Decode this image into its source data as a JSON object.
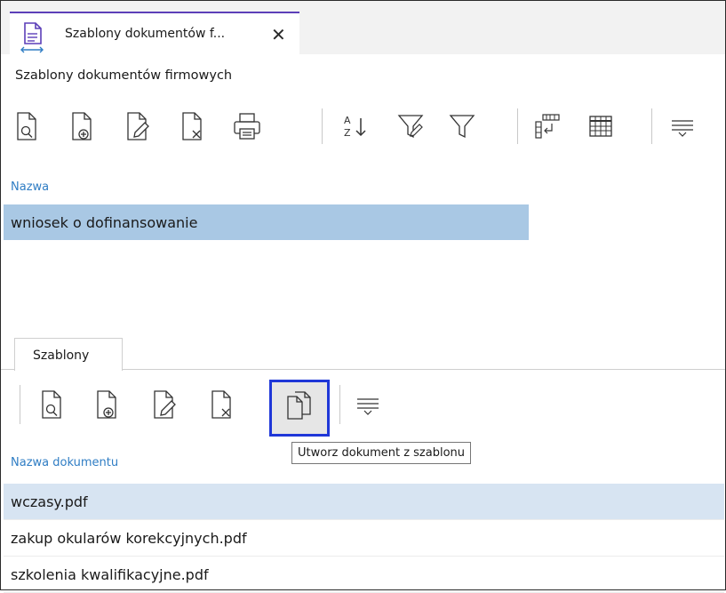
{
  "tab": {
    "title": "Szablony dokumentów f...",
    "icon": "document-arrows-icon"
  },
  "subtitle": "Szablony dokumentów firmowych",
  "toolbar1": {
    "buttons": [
      "preview-icon",
      "add-document-icon",
      "edit-document-icon",
      "delete-document-icon",
      "print-icon",
      "sort-az-icon",
      "filter-clear-icon",
      "filter-icon",
      "column-chooser-icon",
      "grid-icon",
      "more-icon"
    ]
  },
  "list1": {
    "column_header": "Nazwa",
    "rows": [
      "wniosek o dofinansowanie"
    ],
    "selected_index": 0
  },
  "tabs2": {
    "label": "Szablony"
  },
  "toolbar2": {
    "buttons": [
      "preview-icon",
      "add-document-icon",
      "edit-document-icon",
      "delete-document-icon",
      "copy-documents-icon",
      "more-icon"
    ],
    "highlighted": "copy-documents-icon",
    "tooltip": "Utworz dokument z szablonu"
  },
  "list2": {
    "column_header": "Nazwa dokumentu",
    "rows": [
      "wczasy.pdf",
      "zakup okularów korekcyjnych.pdf",
      "szkolenia kwalifikacyjne.pdf"
    ],
    "selected_index": 0
  },
  "colors": {
    "accent": "#5c3fb8",
    "selection": "#a9c8e4",
    "highlight_border": "#1f37d8",
    "header_text": "#2f7dc4"
  }
}
